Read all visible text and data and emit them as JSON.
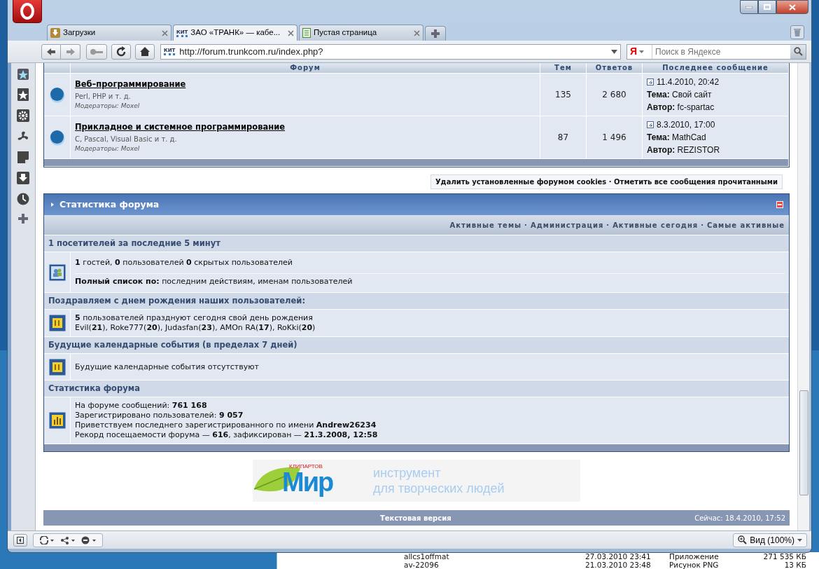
{
  "browser": {
    "tabs": [
      {
        "label": "Загрузки",
        "selected": false,
        "kind": "download"
      },
      {
        "label": "ЗАО «ТРАНК» — кабе...",
        "selected": true,
        "kind": "site",
        "badge": "КИТ"
      },
      {
        "label": "Пустая страница",
        "selected": false,
        "kind": "page"
      }
    ],
    "address": "http://forum.trunkcom.ru/index.php?",
    "site_badge": "КИТ",
    "search": {
      "placeholder": "Поиск в Яндексе",
      "engine_letter": "Я"
    },
    "zoom": "Вид (100%)"
  },
  "forum_table": {
    "columns": [
      "Форум",
      "Тем",
      "Ответов",
      "Последнее сообщение"
    ],
    "rows": [
      {
        "title": "Веб–программирование",
        "description": "Perl, PHP и т. д.",
        "moderators_label": "Модераторы:",
        "moderator": "Moxel",
        "topics": "135",
        "replies": "2 680",
        "last_date": "11.4.2010, 20:42",
        "topic_label": "Тема:",
        "topic": "Свой сайт",
        "author_label": "Автор:",
        "author": "fc-spartac"
      },
      {
        "title": "Прикладное и системное программирование",
        "description": "C, Pascal, Visual Basic и т. д.",
        "moderators_label": "Модераторы:",
        "moderator": "Moxel",
        "topics": "87",
        "replies": "1 496",
        "last_date": "8.3.2010, 17:00",
        "topic_label": "Тема:",
        "topic": "MathCad",
        "author_label": "Автор:",
        "author": "REZISTOR"
      }
    ]
  },
  "separator": "·",
  "forum_links": [
    "Удалить установленные форумом cookies",
    "Отметить все сообщения прочитанными"
  ],
  "stats": {
    "title": "Статистика форума",
    "links": [
      "Активные темы",
      "Администрация",
      "Активные сегодня",
      "Самые активные"
    ],
    "sections": [
      {
        "heading": "1 посетителей за последние 5 минут",
        "kind": "online",
        "text": "**1** гостей, **0** пользователей **0** скрытых пользователей",
        "list_label": "Полный список по:",
        "links": [
          "последним действиям",
          "именам пользователей"
        ],
        "joiner": ", "
      },
      {
        "heading": "Поздравляем с днем рождения наших пользователей:",
        "kind": "birthdays",
        "text": "**5** пользователей празднуют сегодня свой день рождения",
        "users": [
          {
            "name": "Evil",
            "age": "(**21**)"
          },
          {
            "name": "Roke777",
            "age": "(**20**)"
          },
          {
            "name": "Judasfan",
            "age": "(**23**)"
          },
          {
            "name": "AMOn RA",
            "age": "(**17**)"
          },
          {
            "name": "RoKki",
            "age": "(**20**)"
          }
        ],
        "joiner": ", "
      },
      {
        "heading": "Будущие календарные события (в пределах 7 дней)",
        "kind": "events",
        "text": "Будущие календарные события отсутствуют"
      },
      {
        "heading": "Статистика форума",
        "kind": "totals",
        "lines": [
          {
            "text": "На форуме сообщений: **761 168**"
          },
          {
            "text": "Зарегистрировано пользователей: **9 057**"
          },
          {
            "text": "Приветствуем последнего зарегистрированного по имени ",
            "link": "Andrew26234"
          },
          {
            "text": "Рекорд посещаемости форума — **616**, зафиксирован — **21.3.2008, 12:58**"
          }
        ]
      }
    ]
  },
  "banner": {
    "logo_small": "КЛИПАРТОВ",
    "logo": "Мир",
    "tagline": [
      "инструмент",
      "для творческих людей"
    ]
  },
  "footer": {
    "link": "Текстовая версия",
    "time": "Сейчас: 18.4.2010, 17:52"
  },
  "desktop_files": [
    {
      "name": "allcs1offmat",
      "date": "27.03.2010 23:41",
      "type": "Приложение",
      "size": "271 535 КБ"
    },
    {
      "name": "av-22096",
      "date": "21.03.2010 23:48",
      "type": "Рисунок PNG",
      "size": "13 КБ"
    }
  ]
}
